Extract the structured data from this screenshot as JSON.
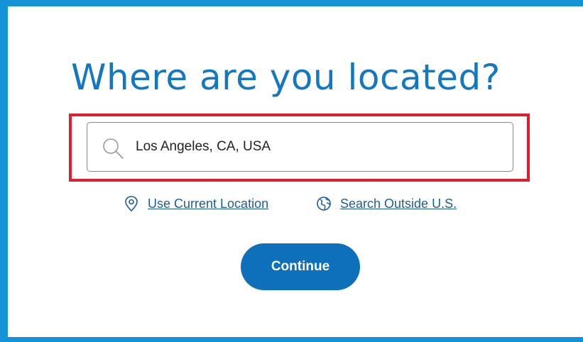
{
  "heading": "Where are you located?",
  "search": {
    "value": "Los Angeles, CA, USA",
    "icon": "search-icon"
  },
  "links": {
    "current_location": {
      "label": "Use Current Location",
      "icon": "location-pin-icon"
    },
    "outside_us": {
      "label": "Search Outside U.S.",
      "icon": "globe-icon"
    }
  },
  "continue_label": "Continue",
  "colors": {
    "frame": "#1493d6",
    "heading": "#1478c0",
    "link": "#1c5d99",
    "button": "#0e6fba",
    "highlight": "#e11d2e"
  }
}
